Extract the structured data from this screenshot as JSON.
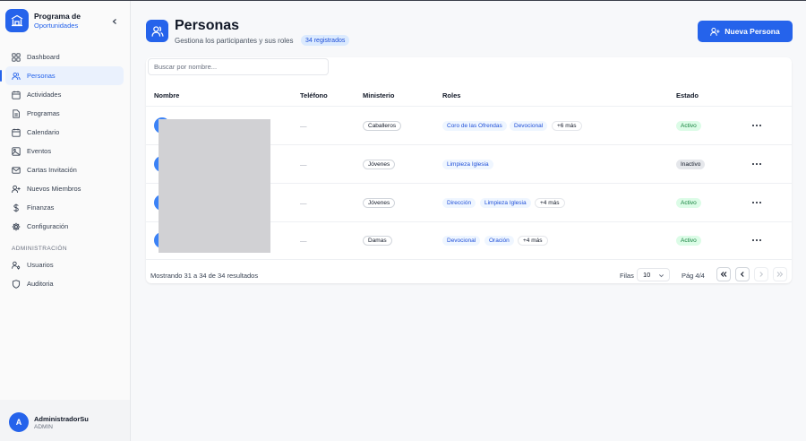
{
  "brand": {
    "title": "Programa de",
    "subtitle": "Oportunidades"
  },
  "nav": {
    "items": [
      {
        "label": "Dashboard",
        "icon": "dashboard-icon"
      },
      {
        "label": "Personas",
        "icon": "users-icon",
        "active": true
      },
      {
        "label": "Actividades",
        "icon": "calendar-icon"
      },
      {
        "label": "Programas",
        "icon": "document-icon"
      },
      {
        "label": "Calendario",
        "icon": "calendar-icon"
      },
      {
        "label": "Eventos",
        "icon": "image-icon"
      },
      {
        "label": "Cartas Invitación",
        "icon": "mail-icon"
      },
      {
        "label": "Nuevos Miembros",
        "icon": "user-plus-icon"
      },
      {
        "label": "Finanzas",
        "icon": "dollar-icon"
      },
      {
        "label": "Configuración",
        "icon": "gear-icon"
      }
    ],
    "admin_section": "ADMINISTRACIÓN",
    "admin_items": [
      {
        "label": "Usuarios",
        "icon": "user-key-icon"
      },
      {
        "label": "Auditoria",
        "icon": "shield-icon"
      }
    ]
  },
  "user": {
    "initial": "A",
    "name": "AdministradorSu",
    "role": "ADMIN"
  },
  "header": {
    "title": "Personas",
    "subtitle": "Gestiona los participantes y sus roles",
    "badge": "34 registrados",
    "new_button": "Nueva Persona"
  },
  "search": {
    "placeholder": "Buscar por nombre..."
  },
  "table": {
    "columns": {
      "name": "Nombre",
      "phone": "Teléfono",
      "ministry": "Ministerio",
      "roles": "Roles",
      "status": "Estado"
    },
    "rows": [
      {
        "phone": "—",
        "ministry": "Caballeros",
        "roles": [
          "Coro de las Ofrendas",
          "Devocional"
        ],
        "more": "+6 más",
        "status": "Activo"
      },
      {
        "phone": "—",
        "ministry": "Jóvenes",
        "roles": [
          "Limpieza Iglesia"
        ],
        "more": "",
        "status": "Inactivo"
      },
      {
        "phone": "—",
        "ministry": "Jóvenes",
        "roles": [
          "Dirección",
          "Limpieza Iglesia"
        ],
        "more": "+4 más",
        "status": "Activo"
      },
      {
        "phone": "—",
        "ministry": "Damas",
        "roles": [
          "Devocional",
          "Oración"
        ],
        "more": "+4 más",
        "status": "Activo"
      }
    ]
  },
  "footer": {
    "showing": "Mostrando 31 a 34 de 34 resultados",
    "rows_label": "Filas",
    "rows_value": "10",
    "page_label": "Pág 4/4"
  },
  "colors": {
    "accent": "#2563eb",
    "active": "#15803d",
    "inactive": "#e5e7eb"
  }
}
